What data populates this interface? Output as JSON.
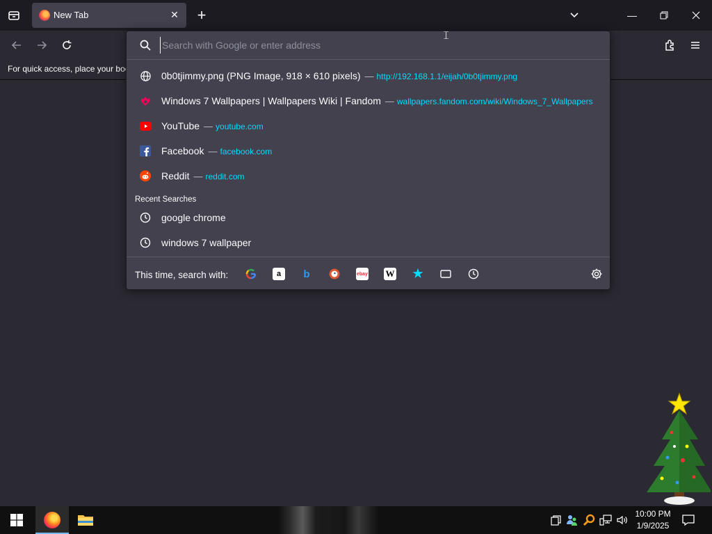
{
  "window": {
    "tab_title": "New Tab",
    "new_tab_label": "+"
  },
  "bookmarks_bar": {
    "hint": "For quick access, place your boc"
  },
  "urlbar": {
    "placeholder": "Search with Google or enter address",
    "value": ""
  },
  "results": [
    {
      "icon": "globe-icon",
      "title": "0b0tjimmy.png (PNG Image, 918 × 610 pixels)",
      "separator": "—",
      "url": "http://192.168.1.1/eijah/0b0tjimmy.png"
    },
    {
      "icon": "fandom-icon",
      "title": "Windows 7 Wallpapers | Wallpapers Wiki | Fandom",
      "separator": "—",
      "url": "wallpapers.fandom.com/wiki/Windows_7_Wallpapers"
    },
    {
      "icon": "youtube-icon",
      "title": "YouTube",
      "separator": "—",
      "url": "youtube.com"
    },
    {
      "icon": "facebook-icon",
      "title": "Facebook",
      "separator": "—",
      "url": "facebook.com"
    },
    {
      "icon": "reddit-icon",
      "title": "Reddit",
      "separator": "—",
      "url": "reddit.com"
    }
  ],
  "recent_searches": {
    "header": "Recent Searches",
    "items": [
      "google chrome",
      "windows 7 wallpaper"
    ]
  },
  "one_off": {
    "label": "This time, search with:",
    "engines": [
      "google",
      "amazon",
      "bing",
      "duckduckgo",
      "ebay",
      "wikipedia",
      "bookmarks",
      "tabs",
      "history"
    ]
  },
  "taskbar": {
    "time": "10:00 PM",
    "date": "1/9/2025"
  },
  "colors": {
    "accent_url": "#00ddff",
    "panel": "#42414d",
    "background": "#2b2a33"
  }
}
